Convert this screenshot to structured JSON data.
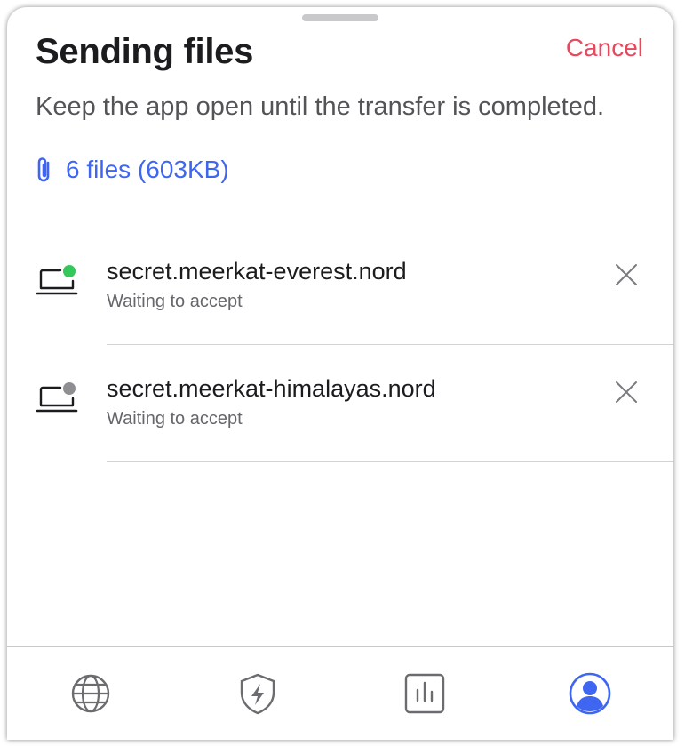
{
  "sheet": {
    "title": "Sending files",
    "cancel_label": "Cancel",
    "subtitle": "Keep the app open until the transfer is completed.",
    "files_summary": "6 files (603KB)"
  },
  "devices": [
    {
      "name": "secret.meerkat-everest.nord",
      "status": "Waiting to accept",
      "online_color": "#34c759"
    },
    {
      "name": "secret.meerkat-himalayas.nord",
      "status": "Waiting to accept",
      "online_color": "#8e8e93"
    }
  ],
  "tabbar": {
    "items": [
      {
        "icon": "globe-icon",
        "active": false
      },
      {
        "icon": "shield-bolt-icon",
        "active": false
      },
      {
        "icon": "bar-chart-icon",
        "active": false
      },
      {
        "icon": "profile-icon",
        "active": true
      }
    ]
  },
  "colors": {
    "accent": "#3e66f0",
    "cancel": "#e8475c",
    "text_primary": "#1c1c1e",
    "text_secondary": "#66666b",
    "icon_inactive": "#6b6b70"
  }
}
